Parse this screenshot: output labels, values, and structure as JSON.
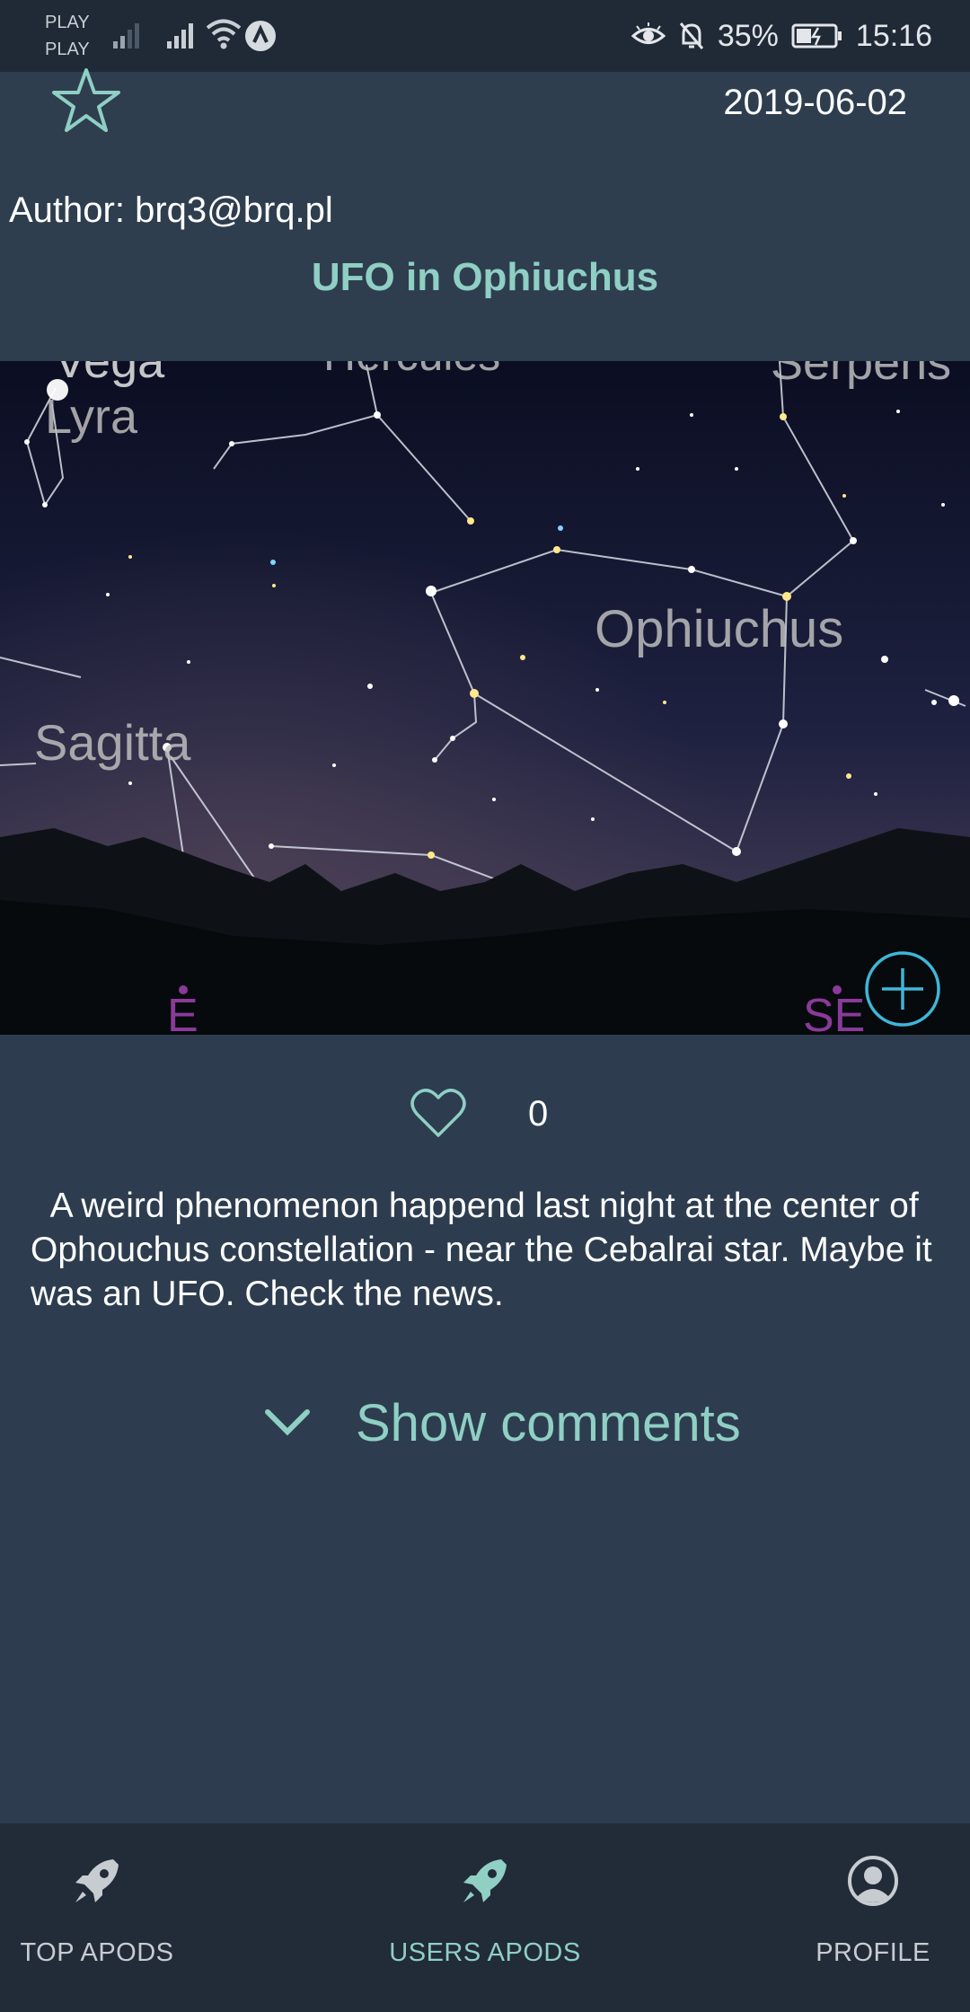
{
  "status_bar": {
    "carrier_1": "PLAY",
    "carrier_2": "PLAY",
    "battery": "35%",
    "time": "15:16"
  },
  "post": {
    "date": "2019-06-02",
    "author": "Author: brq3@brq.pl",
    "title": "UFO in Ophiuchus",
    "likes": "0",
    "description": "A weird phenomenon happend last night at the center of Ophouchus constellation - near the Cebalrai star. Maybe it was an UFO. Check the news.",
    "show_comments": "Show comments"
  },
  "photo": {
    "labels": {
      "vega": "Vega",
      "hercules": "Hercules",
      "serpens": "Serpens",
      "lyra": "Lyra",
      "ophiuchus": "Ophiuchus",
      "sagitta": "Sagitta",
      "compass_e": "E",
      "compass_se": "SE"
    }
  },
  "nav": {
    "items": [
      {
        "label": "TOP APODS",
        "icon": "rocket-icon",
        "active": false
      },
      {
        "label": "USERS APODS",
        "icon": "rocket-icon",
        "active": true
      },
      {
        "label": "PROFILE",
        "icon": "profile-icon",
        "active": false
      }
    ]
  },
  "colors": {
    "accent": "#8fcfc4",
    "background": "#2d3d4f",
    "nav_background": "#222b38",
    "status_background": "#1f2a36"
  }
}
